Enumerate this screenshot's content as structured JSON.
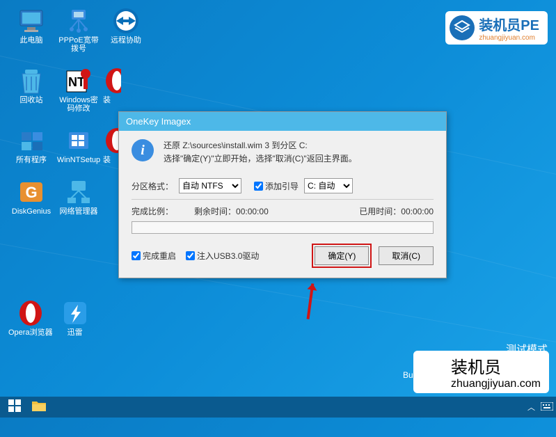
{
  "desktop": {
    "icons": [
      {
        "label": "此电脑",
        "svg": "pc"
      },
      {
        "label": "PPPoE宽带拨号",
        "svg": "network"
      },
      {
        "label": "远程协助",
        "svg": "teamviewer"
      },
      {
        "label": "回收站",
        "svg": "recycle"
      },
      {
        "label": "Windows密码修改",
        "svg": "ntpw"
      },
      {
        "label": "装",
        "svg": "opera-partial"
      },
      {
        "label": "所有程序",
        "svg": "programs"
      },
      {
        "label": "WinNTSetup",
        "svg": "winnt"
      },
      {
        "label": "装",
        "svg": "opera-partial2"
      },
      {
        "label": "DiskGenius",
        "svg": "diskgenius"
      },
      {
        "label": "网络管理器",
        "svg": "netmgr"
      }
    ],
    "row5": [
      {
        "label": "Opera浏览器",
        "svg": "opera"
      },
      {
        "label": "迅雷",
        "svg": "xunlei"
      }
    ]
  },
  "badge": {
    "main": "装机员PE",
    "sub": "zhuangjiyuan.com",
    "main2": "装机员",
    "sub2": "zhuangjiyuan.com"
  },
  "dialog": {
    "title": "OneKey Imagex",
    "msg_line1": "还原 Z:\\sources\\install.wim 3 到分区 C:",
    "msg_line2": "选择\"确定(Y)\"立即开始，选择\"取消(C)\"返回主界面。",
    "label_format": "分区格式：",
    "select_format": "自动 NTFS",
    "cb_addboot": "添加引导",
    "select_boot": "C: 自动",
    "label_ratio": "完成比例：",
    "label_remain": "剩余时间：",
    "val_remain": "00:00:00",
    "label_elapsed": "已用时间：",
    "val_elapsed": "00:00:00",
    "cb_reboot": "完成重启",
    "cb_usb3": "注入USB3.0驱动",
    "btn_ok": "确定(Y)",
    "btn_cancel": "取消(C)"
  },
  "footer": {
    "test_mode": "测试模式",
    "build": "Buil"
  }
}
